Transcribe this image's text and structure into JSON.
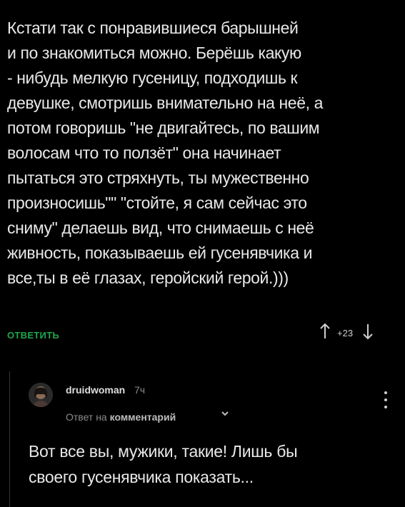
{
  "comment": {
    "lines": [
      "Кстати так с понравившиеся барышней",
      "и по знакомиться можно. Берёшь какую",
      "- нибудь мелкую гусеницу, подходишь к",
      "девушке, смотришь внимательно на неё, а",
      "потом говоришь \"не двигайтесь, по вашим",
      "волосам что то ползёт\" она начинает",
      "пытаться это стряхнуть, ты мужественно",
      "произносишь\"\" \"стойте, я сам сейчас это",
      "сниму\" делаешь вид, что снимаешь с неё",
      "живность, показываешь ей гусенявчика и",
      "все,ты в её глазах, геройский герой.)))"
    ],
    "reply_label": "ОТВЕТИТЬ",
    "rating": "+23"
  },
  "icons": {
    "upvote": "up-arrow-icon",
    "downvote": "down-arrow-icon",
    "menu": "vertical-dots-icon",
    "chevron": "chevron-down-icon"
  },
  "reply": {
    "username": "druidwoman",
    "time": "7ч",
    "reply_to_prefix": "Ответ на",
    "reply_to_link": "комментарий",
    "lines": [
      "Вот все вы, мужики, такие! Лишь бы",
      "своего гусенявчика показать..."
    ]
  },
  "colors": {
    "background": "#000000",
    "accent": "#1fa64c",
    "text": "#e8e8e8",
    "muted": "#8a8a8a"
  }
}
